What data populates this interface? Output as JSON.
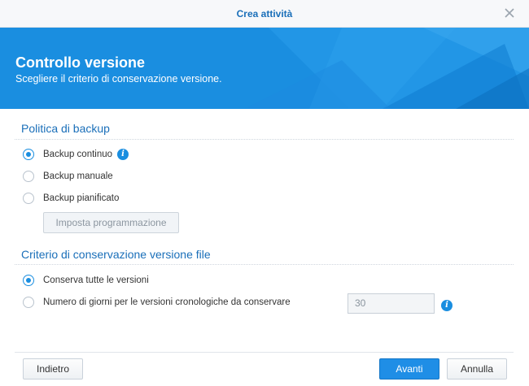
{
  "window": {
    "title": "Crea attività"
  },
  "banner": {
    "title": "Controllo versione",
    "subtitle": "Scegliere il criterio di conservazione versione."
  },
  "backup_policy": {
    "heading": "Politica di backup",
    "options": [
      {
        "label": "Backup continuo",
        "checked": true
      },
      {
        "label": "Backup manuale",
        "checked": false
      },
      {
        "label": "Backup pianificato",
        "checked": false
      }
    ],
    "schedule_button": "Imposta programmazione"
  },
  "retention": {
    "heading": "Criterio di conservazione versione file",
    "options": [
      {
        "label": "Conserva tutte le versioni",
        "checked": true
      },
      {
        "label": "Numero di giorni per le versioni cronologiche da conservare",
        "checked": false
      }
    ],
    "days_value": "30"
  },
  "footer": {
    "back": "Indietro",
    "next": "Avanti",
    "cancel": "Annulla"
  },
  "icons": {
    "close": "close-icon",
    "info": "info-icon",
    "info_glyph": "i"
  },
  "colors": {
    "accent": "#1a8ee0",
    "heading": "#1a6fb9",
    "primary_button": "#1f8ee6"
  }
}
